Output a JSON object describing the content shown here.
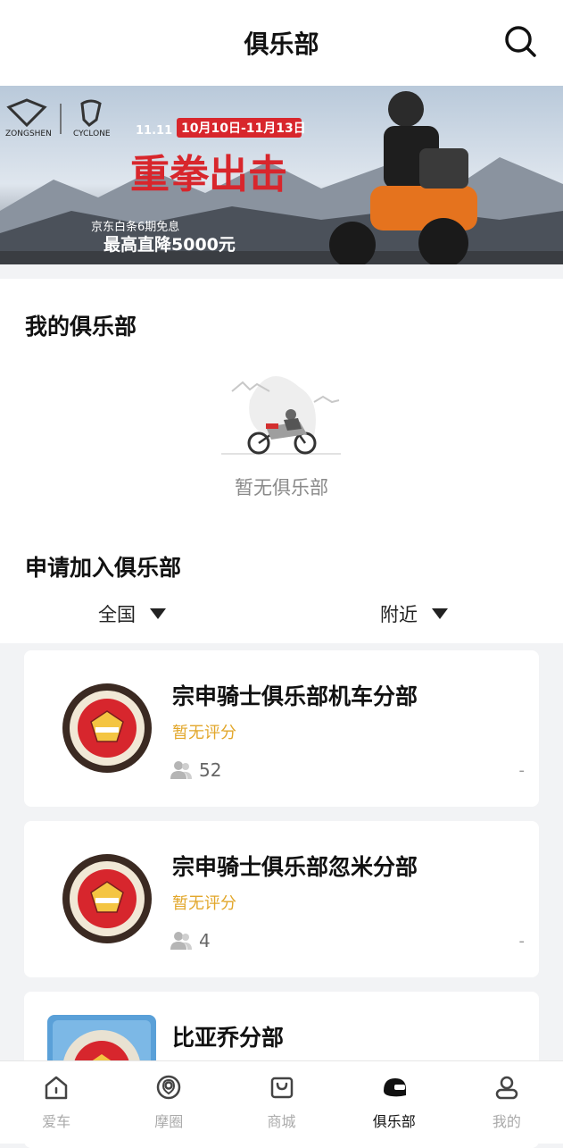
{
  "header": {
    "title": "俱乐部"
  },
  "banner": {
    "brand1": "ZONGSHEN",
    "brand2": "CYCLONE",
    "promo_date": "10月10日-11月13日",
    "headline": "重拳出击",
    "sub1": "京东白条6期免息",
    "sub2": "最高直降5000元"
  },
  "my_clubs": {
    "title": "我的俱乐部",
    "empty_text": "暂无俱乐部"
  },
  "join_clubs": {
    "title": "申请加入俱乐部",
    "filter_region": "全国",
    "filter_nearby": "附近"
  },
  "clubs": [
    {
      "name": "宗申骑士俱乐部机车分部",
      "rating": "暂无评分",
      "members": "52",
      "distance": "-"
    },
    {
      "name": "宗申骑士俱乐部忽米分部",
      "rating": "暂无评分",
      "members": "4",
      "distance": "-"
    },
    {
      "name": "比亚乔分部",
      "rating": "",
      "members": "",
      "distance": ""
    }
  ],
  "tabs": [
    {
      "label": "爱车",
      "icon": "home-icon"
    },
    {
      "label": "摩圈",
      "icon": "location-icon"
    },
    {
      "label": "商城",
      "icon": "bag-icon"
    },
    {
      "label": "俱乐部",
      "icon": "helmet-icon",
      "active": true
    },
    {
      "label": "我的",
      "icon": "user-icon"
    }
  ],
  "colors": {
    "accent": "#e2a72b",
    "active_tab": "#111111",
    "inactive_tab": "#aaaaaa"
  }
}
